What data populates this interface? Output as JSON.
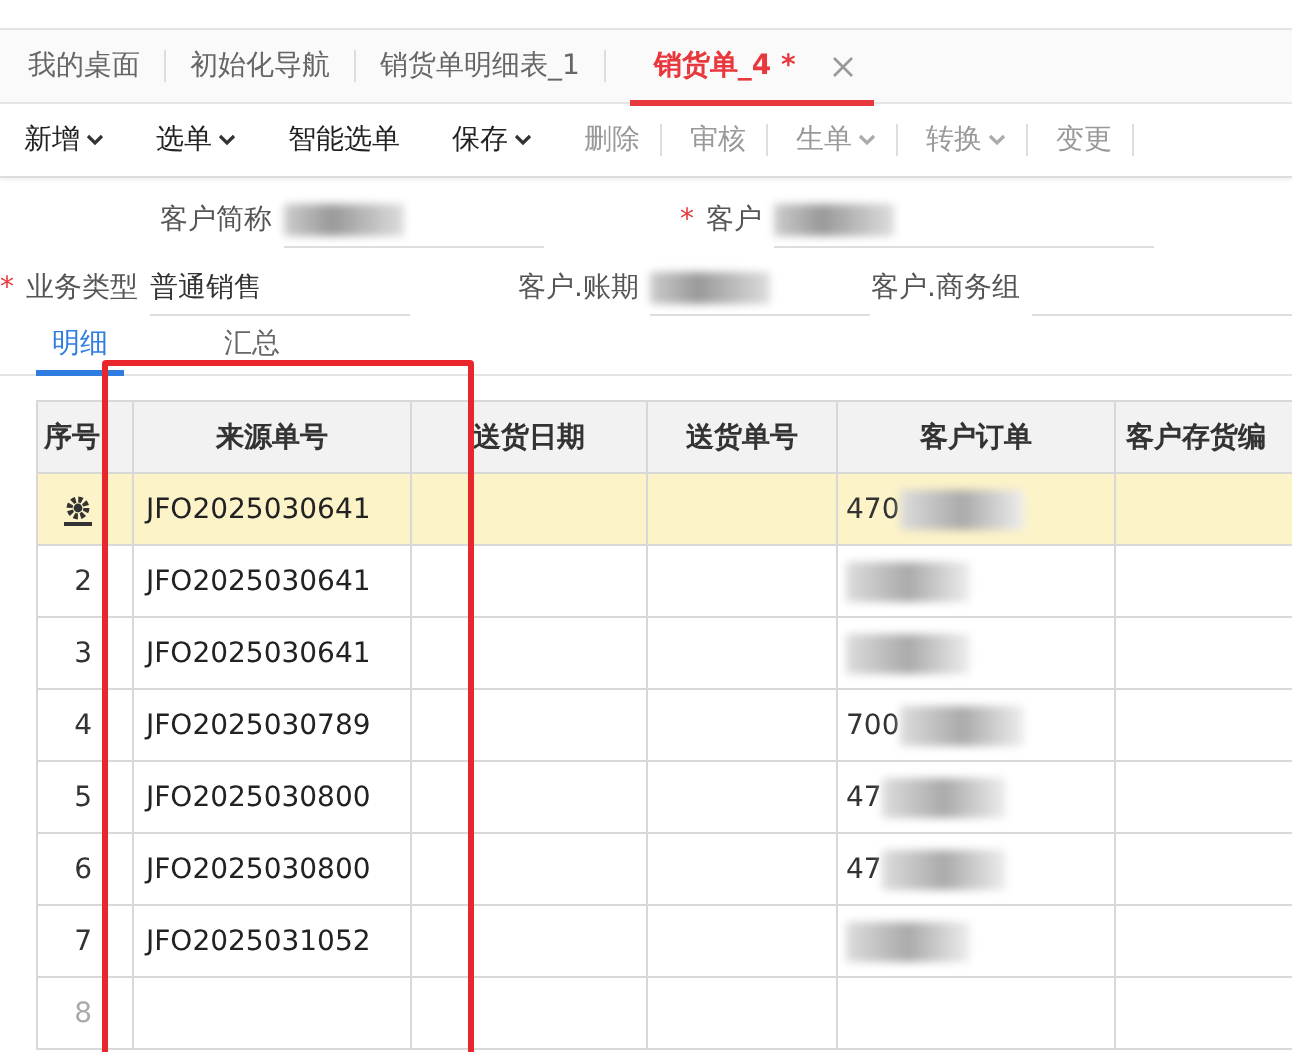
{
  "tabs": [
    {
      "label": "我的桌面",
      "selected": false
    },
    {
      "label": "初始化导航",
      "selected": false
    },
    {
      "label": "销货单明细表_1",
      "selected": false
    },
    {
      "label": "销货单_4 *",
      "selected": true,
      "closable": true
    }
  ],
  "toolbar": [
    {
      "label": "新增",
      "dropdown": true,
      "disabled": false
    },
    {
      "label": "选单",
      "dropdown": true,
      "disabled": false
    },
    {
      "label": "智能选单",
      "disabled": false
    },
    {
      "label": "保存",
      "dropdown": true,
      "disabled": false
    },
    {
      "label": "删除",
      "disabled": true
    },
    {
      "label": "审核",
      "disabled": true
    },
    {
      "label": "生单",
      "dropdown": true,
      "disabled": true
    },
    {
      "label": "转换",
      "dropdown": true,
      "disabled": true
    },
    {
      "label": "变更",
      "disabled": true
    }
  ],
  "form": {
    "rows": [
      [
        {
          "label": "客户简称",
          "redacted": true
        },
        {
          "required_mark": "*",
          "label": "客户",
          "redacted": true
        }
      ],
      [
        {
          "required_mark": "*",
          "label": "业务类型",
          "value": "普通销售"
        },
        {
          "label": "客户.账期",
          "redacted": true
        },
        {
          "label": "客户.商务组"
        }
      ]
    ]
  },
  "detail_tabs": [
    {
      "label": "明细",
      "selected": true
    },
    {
      "label": "汇总",
      "selected": false
    }
  ],
  "table": {
    "columns": [
      "序号",
      "来源单号",
      "送货日期",
      "送货单号",
      "客户订单",
      "客户存货编"
    ],
    "rows": [
      {
        "gear": true,
        "highlighted": true,
        "source": "JFO2025030641",
        "order_prefix": "470",
        "order_redacted": true
      },
      {
        "seq": "2",
        "highlighted": false,
        "source": "JFO2025030641",
        "order_redacted": true
      },
      {
        "seq": "3",
        "highlighted": false,
        "source": "JFO2025030641",
        "order_redacted": true
      },
      {
        "seq": "4",
        "highlighted": false,
        "source": "JFO2025030789",
        "order_prefix": "700",
        "order_redacted": true
      },
      {
        "seq": "5",
        "highlighted": false,
        "source": "JFO2025030800",
        "order_prefix": "47",
        "order_redacted": true
      },
      {
        "seq": "6",
        "highlighted": false,
        "source": "JFO2025030800",
        "order_prefix": "47",
        "order_redacted": true
      },
      {
        "seq": "7",
        "highlighted": false,
        "source": "JFO2025031052",
        "order_redacted": true
      }
    ],
    "new_row_number": "8"
  },
  "annotation": {
    "kind": "red-box"
  }
}
